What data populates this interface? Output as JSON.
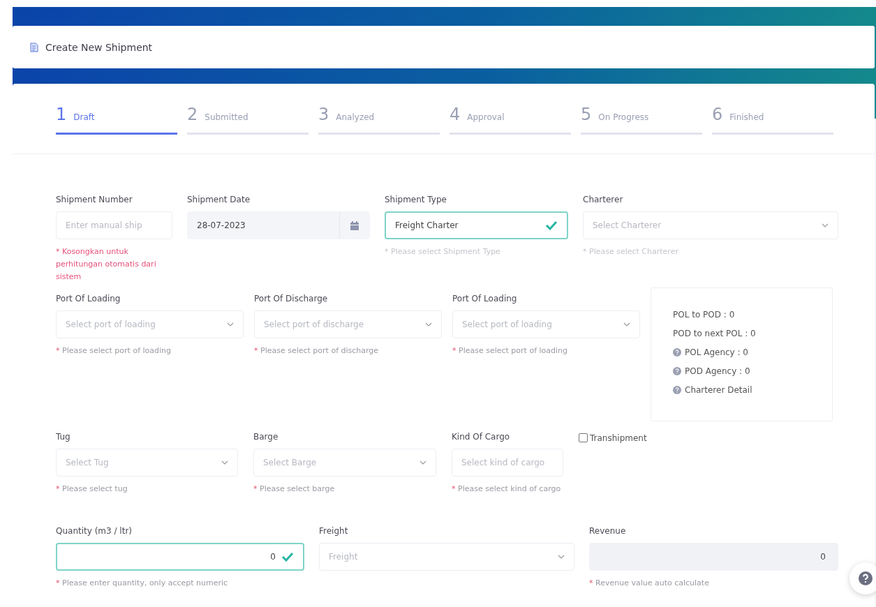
{
  "header": {
    "title": "Create New Shipment"
  },
  "steps": [
    {
      "number": "1",
      "label": "Draft",
      "selected": true
    },
    {
      "number": "2",
      "label": "Submitted",
      "selected": false
    },
    {
      "number": "3",
      "label": "Analyzed",
      "selected": false
    },
    {
      "number": "4",
      "label": "Approval",
      "selected": false
    },
    {
      "number": "5",
      "label": "On Progress",
      "selected": false
    },
    {
      "number": "6",
      "label": "Finished",
      "selected": false
    }
  ],
  "rows": [
    {
      "fields": [
        {
          "kind": "text",
          "label": "Shipment Number",
          "placeholder": "Enter manual ship",
          "hint": {
            "mark": "*",
            "text": "Kosongkan untuk perhitungan otomatis dari sistem",
            "kind": "error"
          }
        },
        {
          "kind": "date",
          "label": "Shipment Date",
          "value": "28-07-2023"
        },
        {
          "kind": "select",
          "label": "Shipment Type",
          "value": "Freight Charter",
          "valid": true,
          "hint": {
            "mark": "*",
            "text": "Please select Shipment Type",
            "kind": "muted"
          }
        },
        {
          "kind": "select",
          "label": "Charterer",
          "placeholder": "Select Charterer",
          "valid": false,
          "hint": {
            "mark": "*",
            "text": "Please select Charterer",
            "kind": "muted"
          }
        }
      ]
    },
    {
      "fields": [
        {
          "kind": "select",
          "label": "Port Of Loading",
          "placeholder": "Select port of loading",
          "valid": false,
          "hint": {
            "mark": "*",
            "text": "Please select port of loading",
            "kind": "required"
          }
        },
        {
          "kind": "select",
          "label": "Port Of Discharge",
          "placeholder": "Select port of discharge",
          "valid": false,
          "hint": {
            "mark": "*",
            "text": "Please select port of discharge",
            "kind": "required"
          }
        },
        {
          "kind": "select",
          "label": "Port Of Loading",
          "placeholder": "Select port of loading",
          "valid": false,
          "hint": {
            "mark": "*",
            "text": "Please select port of loading",
            "kind": "required"
          }
        }
      ],
      "info": [
        {
          "kind": "plain",
          "text": "POL to POD : 0"
        },
        {
          "kind": "plain",
          "text": "POD to next POL : 0"
        },
        {
          "kind": "help",
          "text": "POL Agency : 0"
        },
        {
          "kind": "help",
          "text": "POD Agency : 0"
        },
        {
          "kind": "help",
          "text": "Charterer Detail"
        }
      ]
    },
    {
      "fields": [
        {
          "kind": "select",
          "label": "Tug",
          "placeholder": "Select Tug",
          "valid": false,
          "hint": {
            "mark": "*",
            "text": "Please select tug",
            "kind": "required"
          }
        },
        {
          "kind": "select",
          "label": "Barge",
          "placeholder": "Select Barge",
          "valid": false,
          "hint": {
            "mark": "*",
            "text": "Please select barge",
            "kind": "required"
          }
        },
        {
          "kind": "text",
          "label": "Kind Of Cargo",
          "placeholder": "Select kind of cargo",
          "hint": {
            "mark": "*",
            "text": "Please select kind of cargo",
            "kind": "required"
          }
        }
      ],
      "checkbox": {
        "label": "Transhipment",
        "checked": false
      }
    },
    {
      "fields": [
        {
          "kind": "number",
          "label": "Quantity (m3 / ltr)",
          "value": "0",
          "valid": true,
          "hint": {
            "mark": "*",
            "text": "Please enter quantity, only accept numeric",
            "kind": "required"
          }
        },
        {
          "kind": "select",
          "label": "Freight",
          "placeholder": "Freight",
          "valid": false
        },
        {
          "kind": "readonly",
          "label": "Revenue",
          "value": "0",
          "hint": {
            "mark": "*",
            "text": "Revenue value auto calculate",
            "kind": "required"
          }
        }
      ]
    }
  ]
}
